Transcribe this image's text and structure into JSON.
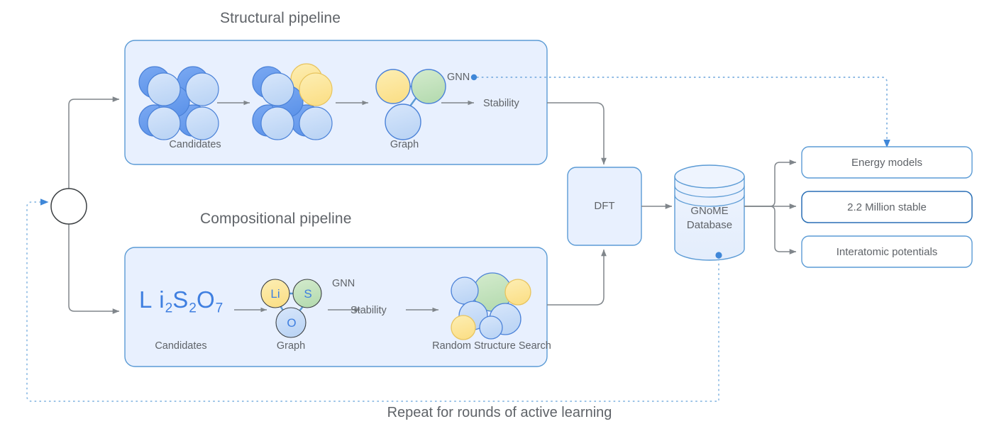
{
  "diagram": {
    "bottom_caption": "Repeat for rounds of active learning",
    "colors": {
      "panel_fill": "#e8f0fe",
      "panel_border": "#5b9bd5",
      "arrow_gray": "#80868b",
      "dotted_blue": "#5b9bd5",
      "accent_blue": "#3f7fe0",
      "atom_blue_dark": "#6b9ef0",
      "atom_blue_light": "#c3d9f7",
      "atom_yellow": "#fce79a",
      "atom_green": "#c6e2c0",
      "atom_pink": "#fad4cc",
      "text_gray": "#5f6368"
    }
  },
  "structural_pipeline": {
    "title": "Structural pipeline",
    "candidates_caption": "Candidates",
    "graph_caption": "Graph",
    "gnn_label": "GNN",
    "stability_label": "Stability"
  },
  "compositional_pipeline": {
    "title": "Compositional pipeline",
    "formula": {
      "parts": [
        {
          "sym": "Li",
          "sub": "2"
        },
        {
          "sym": "S",
          "sub": "2"
        },
        {
          "sym": "O",
          "sub": "7"
        }
      ],
      "text": "Li2S2O7"
    },
    "candidates_caption": "Candidates",
    "graph_caption": "Graph",
    "gnn_label": "GNN",
    "stability_label": "Stability",
    "rss_caption": "Random Structure Search",
    "graph_nodes": [
      {
        "label": "Li",
        "color": "#fce79a"
      },
      {
        "label": "S",
        "color": "#c6e2c0"
      },
      {
        "label": "O",
        "color": "#c3d9f7"
      }
    ]
  },
  "dft": {
    "label": "DFT"
  },
  "database": {
    "line1": "GNoME",
    "line2": "Database"
  },
  "outputs": [
    {
      "label": "Energy models"
    },
    {
      "label": "2.2 Million stable"
    },
    {
      "label": "Interatomic potentials"
    }
  ]
}
